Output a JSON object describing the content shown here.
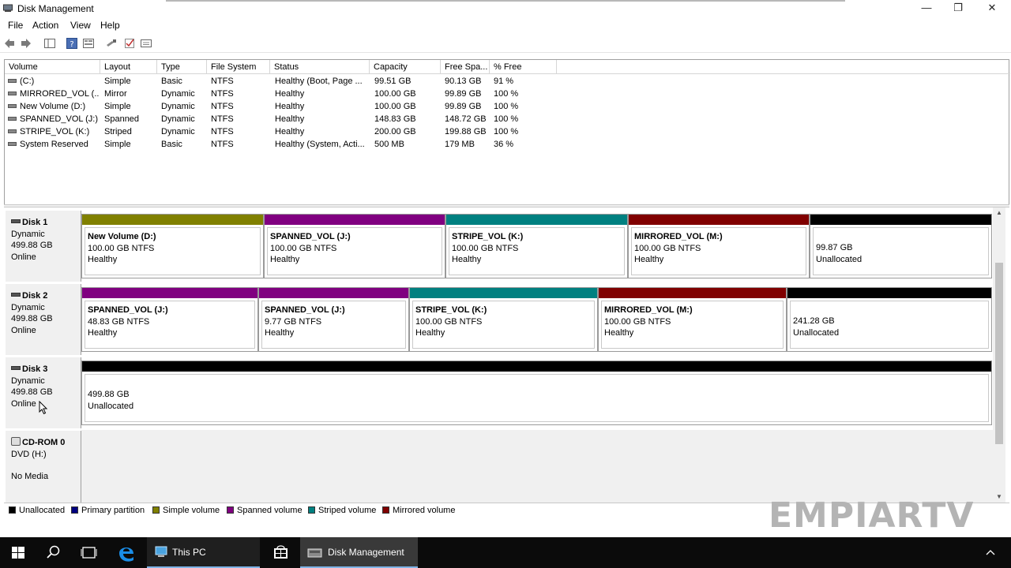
{
  "window": {
    "title": "Disk Management"
  },
  "menu": [
    "File",
    "Action",
    "View",
    "Help"
  ],
  "volume_list": {
    "columns": [
      "Volume",
      "Layout",
      "Type",
      "File System",
      "Status",
      "Capacity",
      "Free Spa...",
      "% Free"
    ],
    "rows": [
      [
        "(C:)",
        "Simple",
        "Basic",
        "NTFS",
        "Healthy (Boot, Page ...",
        "99.51 GB",
        "90.13 GB",
        "91 %"
      ],
      [
        "MIRRORED_VOL (...",
        "Mirror",
        "Dynamic",
        "NTFS",
        "Healthy",
        "100.00 GB",
        "99.89 GB",
        "100 %"
      ],
      [
        "New Volume (D:)",
        "Simple",
        "Dynamic",
        "NTFS",
        "Healthy",
        "100.00 GB",
        "99.89 GB",
        "100 %"
      ],
      [
        "SPANNED_VOL (J:)",
        "Spanned",
        "Dynamic",
        "NTFS",
        "Healthy",
        "148.83 GB",
        "148.72 GB",
        "100 %"
      ],
      [
        "STRIPE_VOL (K:)",
        "Striped",
        "Dynamic",
        "NTFS",
        "Healthy",
        "200.00 GB",
        "199.88 GB",
        "100 %"
      ],
      [
        "System Reserved",
        "Simple",
        "Basic",
        "NTFS",
        "Healthy (System, Acti...",
        "500 MB",
        "179 MB",
        "36 %"
      ]
    ]
  },
  "disks": [
    {
      "name": "Disk 1",
      "type": "Dynamic",
      "size": "499.88 GB",
      "state": "Online",
      "partitions": [
        {
          "name": "New Volume  (D:)",
          "detail": "100.00 GB NTFS",
          "status": "Healthy",
          "color": "#808000"
        },
        {
          "name": "SPANNED_VOL  (J:)",
          "detail": "100.00 GB NTFS",
          "status": "Healthy",
          "color": "#800080"
        },
        {
          "name": "STRIPE_VOL  (K:)",
          "detail": "100.00 GB NTFS",
          "status": "Healthy",
          "color": "#008080"
        },
        {
          "name": "MIRRORED_VOL  (M:)",
          "detail": "100.00 GB NTFS",
          "status": "Healthy",
          "color": "#800000"
        },
        {
          "name": "",
          "detail": "99.87 GB",
          "status": "Unallocated",
          "color": "#000000"
        }
      ]
    },
    {
      "name": "Disk 2",
      "type": "Dynamic",
      "size": "499.88 GB",
      "state": "Online",
      "partitions": [
        {
          "name": "SPANNED_VOL  (J:)",
          "detail": "48.83 GB NTFS",
          "status": "Healthy",
          "color": "#800080"
        },
        {
          "name": "SPANNED_VOL  (J:)",
          "detail": "9.77 GB NTFS",
          "status": "Healthy",
          "color": "#800080"
        },
        {
          "name": "STRIPE_VOL  (K:)",
          "detail": "100.00 GB NTFS",
          "status": "Healthy",
          "color": "#008080"
        },
        {
          "name": "MIRRORED_VOL  (M:)",
          "detail": "100.00 GB NTFS",
          "status": "Healthy",
          "color": "#800000"
        },
        {
          "name": "",
          "detail": "241.28 GB",
          "status": "Unallocated",
          "color": "#000000"
        }
      ]
    },
    {
      "name": "Disk 3",
      "type": "Dynamic",
      "size": "499.88 GB",
      "state": "Online",
      "partitions": [
        {
          "name": "",
          "detail": "499.88 GB",
          "status": "Unallocated",
          "color": "#000000"
        }
      ]
    }
  ],
  "cdrom": {
    "name": "CD-ROM 0",
    "drive": "DVD (H:)",
    "media": "No Media"
  },
  "legend": [
    {
      "label": "Unallocated",
      "color": "#000000"
    },
    {
      "label": "Primary partition",
      "color": "#000080"
    },
    {
      "label": "Simple volume",
      "color": "#808000"
    },
    {
      "label": "Spanned volume",
      "color": "#800080"
    },
    {
      "label": "Striped volume",
      "color": "#008080"
    },
    {
      "label": "Mirrored volume",
      "color": "#800000"
    }
  ],
  "watermark": "EMPIARTV",
  "taskbar": {
    "this_pc": "This PC",
    "disk_management": "Disk Management"
  }
}
